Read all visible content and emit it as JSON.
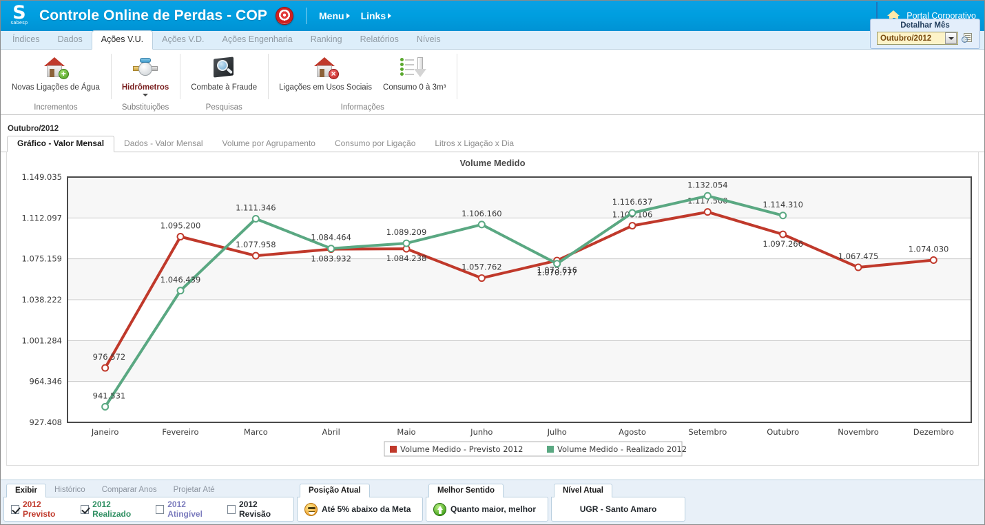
{
  "header": {
    "logo_mark": "S",
    "logo_sub": "sabesp",
    "title": "Controle Online de Perdas - COP",
    "target_icon": "target-icon",
    "menu": [
      {
        "label": "Menu"
      },
      {
        "label": "Links"
      }
    ],
    "portal": {
      "label": "Portal Corporativo",
      "icon": "home-icon"
    }
  },
  "nav_tabs": [
    {
      "label": "Índices",
      "active": false
    },
    {
      "label": "Dados",
      "active": false
    },
    {
      "label": "Ações V.U.",
      "active": true
    },
    {
      "label": "Ações V.D.",
      "active": false
    },
    {
      "label": "Ações Engenharia",
      "active": false
    },
    {
      "label": "Ranking",
      "active": false
    },
    {
      "label": "Relatórios",
      "active": false
    },
    {
      "label": "Níveis",
      "active": false
    }
  ],
  "ribbon": {
    "groups": [
      {
        "title": "Incrementos",
        "buttons": [
          {
            "label": "Novas Ligações de Água",
            "icon": "house-plus-icon",
            "highlight": false,
            "has_dropdown": false
          }
        ]
      },
      {
        "title": "Substituições",
        "buttons": [
          {
            "label": "Hidrômetros",
            "icon": "water-meter-icon",
            "highlight": true,
            "has_dropdown": true
          }
        ]
      },
      {
        "title": "Pesquisas",
        "buttons": [
          {
            "label": "Combate à Fraude",
            "icon": "magnifier-screen-icon",
            "highlight": false,
            "has_dropdown": false
          }
        ]
      },
      {
        "title": "Informações",
        "buttons": [
          {
            "label": "Ligações em Usos Sociais",
            "icon": "house-x-icon",
            "highlight": false,
            "has_dropdown": false
          },
          {
            "label": "Consumo 0 à 3m³",
            "icon": "down-arrow-list-icon",
            "highlight": false,
            "has_dropdown": false
          }
        ]
      }
    ]
  },
  "detalhar": {
    "title": "Detalhar Mês",
    "selected_month": "Outubro/2012",
    "dropdown_icon": "chevron-down-icon",
    "search_icon": "report-search-icon"
  },
  "content": {
    "month_label": "Outubro/2012",
    "subtabs": [
      {
        "label": "Gráfico - Valor Mensal",
        "active": true
      },
      {
        "label": "Dados - Valor Mensal",
        "active": false
      },
      {
        "label": "Volume por Agrupamento",
        "active": false
      },
      {
        "label": "Consumo por Ligação",
        "active": false
      },
      {
        "label": "Litros x Ligação x Dia",
        "active": false
      }
    ]
  },
  "chart_data": {
    "type": "line",
    "title": "Volume Medido",
    "xlabel": "",
    "ylabel": "",
    "grid": true,
    "legend_position": "bottom",
    "categories": [
      "Janeiro",
      "Fevereiro",
      "Marco",
      "Abril",
      "Maio",
      "Junho",
      "Julho",
      "Agosto",
      "Setembro",
      "Outubro",
      "Novembro",
      "Dezembro"
    ],
    "ylim": [
      927408,
      1149035
    ],
    "ytick_labels": [
      "1.149.035",
      "1.112.097",
      "1.075.159",
      "1.038.222",
      "1.001.284",
      "964.346",
      "927.408"
    ],
    "ytick_values": [
      1149035,
      1112097,
      1075159,
      1038222,
      1001284,
      964346,
      927408
    ],
    "series": [
      {
        "name": "Volume Medido - Previsto 2012",
        "color": "#c0392b",
        "values": [
          976572,
          1095200,
          1077958,
          1083932,
          1084238,
          1057762,
          1073616,
          1105106,
          1117500,
          1097266,
          1067475,
          1074030
        ],
        "labels": [
          "976.572",
          "1.095.200",
          "1.077.958",
          "1.083.932",
          "1.084.238",
          "1.057.762",
          "1.073.616",
          "1.105.106",
          "1.117.500",
          "1.097.266",
          "1.067.475",
          "1.074.030"
        ]
      },
      {
        "name": "Volume Medido - Realizado 2012",
        "color": "#5aa882",
        "values": [
          941531,
          1046439,
          1111346,
          1084464,
          1089209,
          1106160,
          1070777,
          1116637,
          1132054,
          1114310,
          null,
          null
        ],
        "labels": [
          "941.531",
          "1.046.439",
          "1.111.346",
          "1.084.464",
          "1.089.209",
          "1.106.160",
          "1.070.777",
          "1.116.637",
          "1.132.054",
          "1.114.310",
          "",
          ""
        ]
      }
    ]
  },
  "bottom": {
    "exibir_panel": {
      "tabs": [
        {
          "label": "Exibir",
          "active": true
        },
        {
          "label": "Histórico",
          "active": false
        },
        {
          "label": "Comparar Anos",
          "active": false
        },
        {
          "label": "Projetar Até",
          "active": false
        }
      ],
      "checkboxes": [
        {
          "label": "2012 Previsto",
          "checked": true,
          "color": "#c0392b"
        },
        {
          "label": "2012 Realizado",
          "checked": true,
          "color": "#2f8f62"
        },
        {
          "label": "2012 Atingível",
          "checked": false,
          "color": "#7b7bbd"
        },
        {
          "label": "2012 Revisão",
          "checked": false,
          "color": "#23282d"
        }
      ]
    },
    "posicao_panel": {
      "tab_label": "Posição Atual",
      "icon": "sad-face-icon",
      "value": "Até 5% abaixo da Meta"
    },
    "sentido_panel": {
      "tab_label": "Melhor Sentido",
      "icon": "arrow-up-circle-icon",
      "value": "Quanto maior, melhor"
    },
    "nivel_panel": {
      "tab_label": "Nível Atual",
      "value": "UGR - Santo Amaro"
    }
  }
}
